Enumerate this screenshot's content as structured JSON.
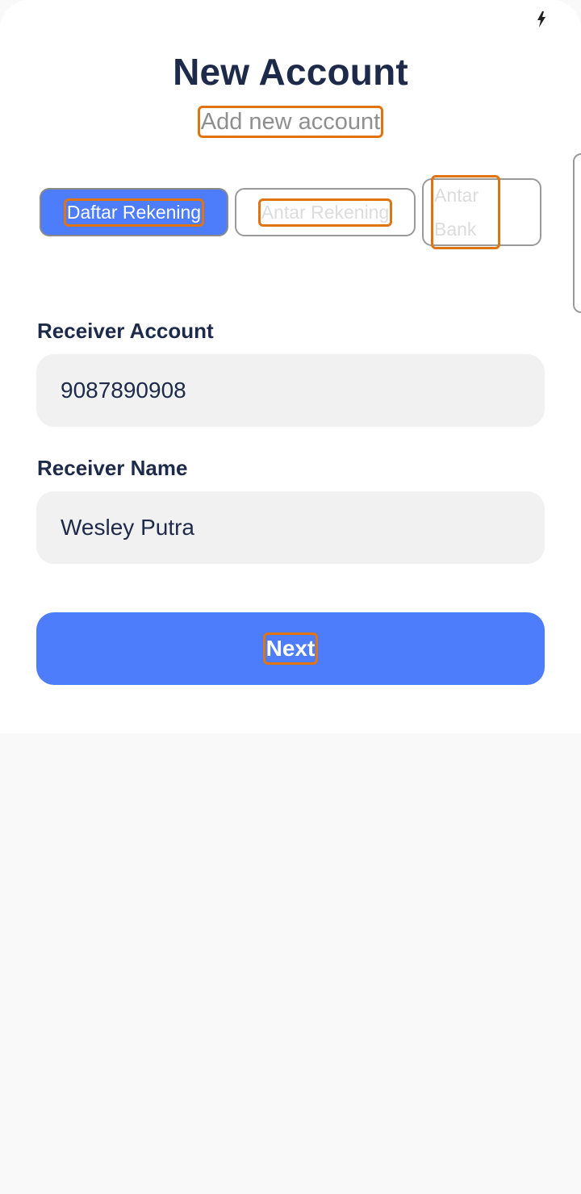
{
  "header": {
    "title": "New Account",
    "subtitle": "Add new account"
  },
  "tabs": [
    {
      "label": "Daftar Rekening",
      "active": true
    },
    {
      "label": "Antar Rekening",
      "active": false
    },
    {
      "label": "Antar Bank",
      "active": false
    }
  ],
  "form": {
    "receiver_account_label": "Receiver Account",
    "receiver_account_value": "9087890908",
    "receiver_name_label": "Receiver Name",
    "receiver_name_value": "Wesley Putra"
  },
  "actions": {
    "next_label": "Next"
  },
  "colors": {
    "accent": "#4e7dfb",
    "title": "#1e2a4a",
    "highlight": "#e07412",
    "field_bg": "#f1f1f1"
  },
  "icons": {
    "status": "lightning-bolt-icon"
  }
}
